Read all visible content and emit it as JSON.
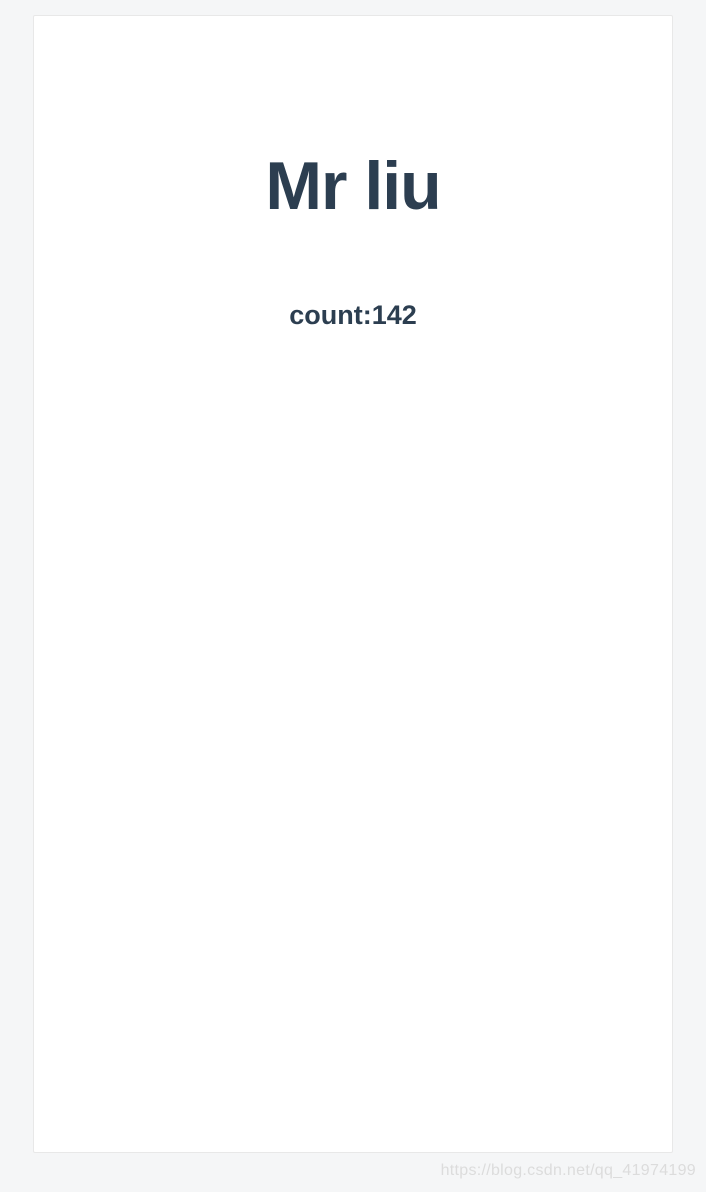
{
  "main": {
    "title": "Mr liu",
    "count_label": "count:",
    "count_value": "142"
  },
  "watermark": "https://blog.csdn.net/qq_41974199"
}
